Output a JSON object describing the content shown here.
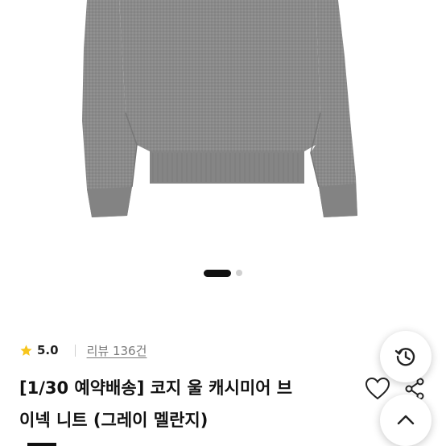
{
  "product": {
    "rating": "5.0",
    "review_link": "리뷰 136건",
    "title_line1": "[1/30 예약배송] 코지 울 캐시미어 브",
    "title_line2": "이넥 니트 (그레이 멜란지)"
  },
  "carousel": {
    "total_images": 2,
    "current_index": 1
  },
  "icons": {
    "star": "star-icon",
    "history": "history-icon",
    "heart": "heart-icon",
    "share": "share-icon",
    "scroll_top": "chevron-up-icon"
  },
  "colors": {
    "star": "#f7c51c",
    "sweater": "#8b8b8b",
    "text": "#111111"
  }
}
